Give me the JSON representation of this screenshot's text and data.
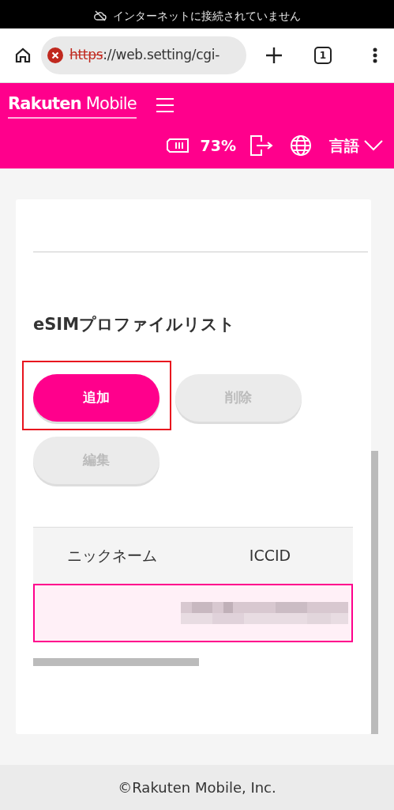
{
  "status_bar": {
    "text": "インターネットに接続されていません"
  },
  "browser": {
    "url_scheme": "https",
    "url_rest": "://web.setting/cgi-",
    "insecure": true,
    "tab_count": "1"
  },
  "header": {
    "logo_bold": "Rakuten",
    "logo_light": "Mobile",
    "battery": "73%",
    "language": "言語"
  },
  "section": {
    "title": "eSIMプロファイルリスト"
  },
  "buttons": [
    {
      "label": "追加",
      "disabled": false,
      "highlighted": true
    },
    {
      "label": "削除",
      "disabled": true,
      "highlighted": false
    },
    {
      "label": "編集",
      "disabled": true,
      "highlighted": false
    }
  ],
  "table": {
    "columns": [
      "ニックネーム",
      "ICCID"
    ],
    "rows": [
      {
        "selected": true,
        "redacted": true
      }
    ]
  },
  "footer": {
    "text": "©Rakuten Mobile, Inc."
  }
}
